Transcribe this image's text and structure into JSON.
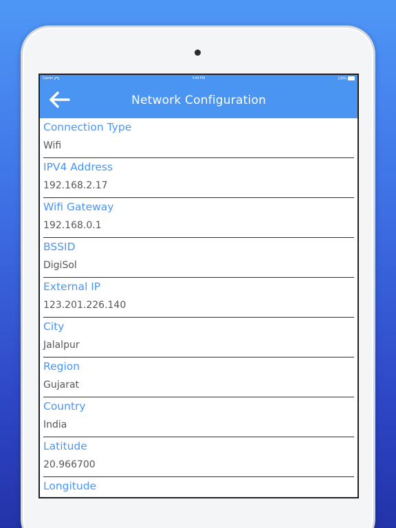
{
  "status_bar": {
    "carrier": "Carrier",
    "time": "4:44 PM",
    "battery": "100%"
  },
  "nav": {
    "title": "Network Configuration",
    "back_icon": "arrow-left-icon"
  },
  "colors": {
    "accent": "#4a95f1",
    "divider": "#232a5e",
    "value_text": "#555555"
  },
  "fields": [
    {
      "label": "Connection Type",
      "value": "Wifi"
    },
    {
      "label": "IPV4 Address",
      "value": "192.168.2.17"
    },
    {
      "label": "Wifi Gateway",
      "value": "192.168.0.1"
    },
    {
      "label": "BSSID",
      "value": "DigiSol"
    },
    {
      "label": "External IP",
      "value": "123.201.226.140"
    },
    {
      "label": "City",
      "value": "Jalalpur"
    },
    {
      "label": "Region",
      "value": "Gujarat"
    },
    {
      "label": "Country",
      "value": "India"
    },
    {
      "label": "Latitude",
      "value": "20.966700"
    },
    {
      "label": "Longitude",
      "value": ""
    }
  ]
}
